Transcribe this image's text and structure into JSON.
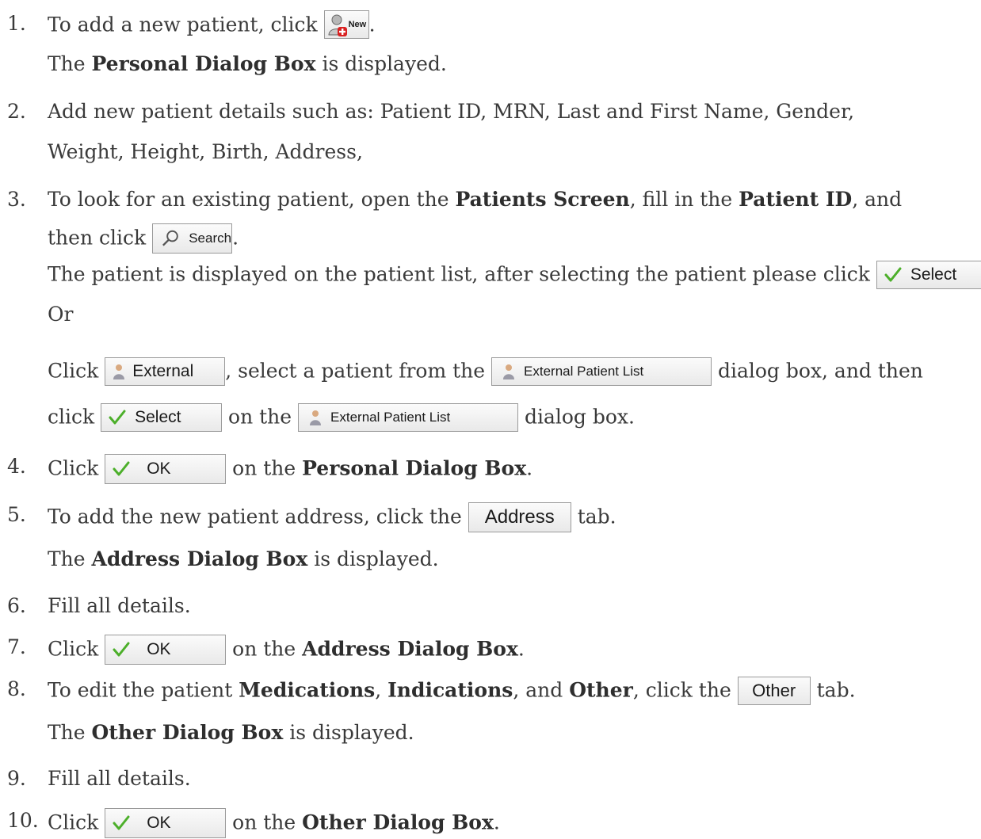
{
  "steps": [
    {
      "num": "1.",
      "a": "To add a new patient, click ",
      "btn": "New",
      "b": ".",
      "sub": [
        "The ",
        "Personal Dialog Box",
        " is displayed."
      ]
    },
    {
      "num": "2.",
      "line1": "Add new patient details such as: Patient ID, MRN, Last and First Name, Gender,",
      "line2": "Weight, Height, Birth, Address,"
    },
    {
      "num": "3.",
      "a": "To look for an existing patient, open the ",
      "b1": "Patients Screen",
      "c": ", fill in the ",
      "b2": "Patient ID",
      "d": ", and",
      "e": "then click ",
      "btn": "Search",
      "f": ".",
      "g": "The patient is displayed on the patient list, after selecting the patient please click ",
      "btn2": "Select",
      "h": ".",
      "or": "Or",
      "i": "Click ",
      "btn3": "External",
      "j": ", select a patient from the ",
      "btn4": "External Patient List",
      "k": " dialog box, and then",
      "l": "click ",
      "btn5": "Select",
      "m": " on the ",
      "btn6": "External Patient List",
      "n": " dialog box."
    },
    {
      "num": "4.",
      "a": "Click ",
      "btn": "OK",
      "b": " on the ",
      "bold": "Personal Dialog Box",
      "c": "."
    },
    {
      "num": "5.",
      "a": "To add the new patient address, click the ",
      "btn": "Address",
      "b": " tab.",
      "sub": [
        "The ",
        "Address Dialog Box",
        " is displayed."
      ]
    },
    {
      "num": "6.",
      "text": "Fill all details."
    },
    {
      "num": "7.",
      "a": "Click ",
      "btn": "OK",
      "b": " on the ",
      "bold": "Address Dialog Box",
      "c": "."
    },
    {
      "num": "8.",
      "a": "To edit the patient ",
      "b1": "Medications",
      ",": ", ",
      "b2": "Indications",
      "c": ", and ",
      "b3": "Other",
      "d": ", click the ",
      "btn": "Other",
      "e": " tab.",
      "sub": [
        "The ",
        "Other Dialog Box",
        " is displayed."
      ]
    },
    {
      "num": "9.",
      "text": "Fill all details."
    },
    {
      "num": "10.",
      "a": "Click ",
      "btn": "OK",
      "b": " on the ",
      "bold": "Other Dialog Box",
      "c": "."
    }
  ],
  "colors": {
    "text": "#3a3a3a",
    "check": "#4caf2a",
    "new_plus": "#d92020"
  }
}
